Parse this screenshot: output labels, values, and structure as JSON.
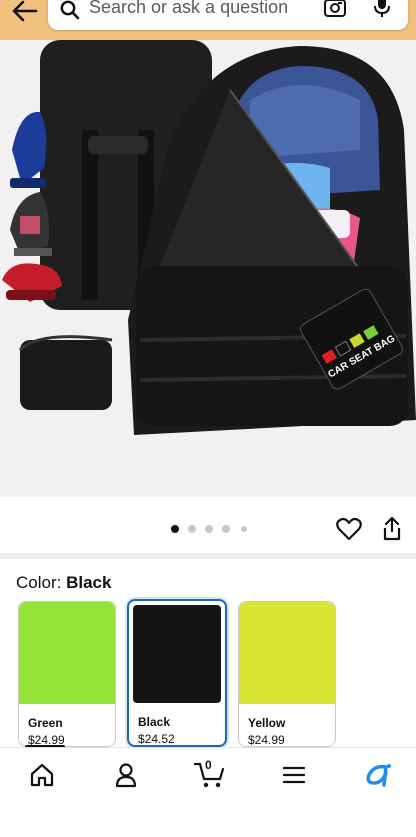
{
  "search": {
    "placeholder": "Search or ask a question"
  },
  "product": {
    "color_label": "Color: ",
    "color_value": "Black",
    "image_badge_text": "CAR SEAT BAG",
    "carousel_dots": 5,
    "active_dot": 0
  },
  "swatches": [
    {
      "name": "Green",
      "price": "$24.99",
      "color": "#95e337"
    },
    {
      "name": "Black",
      "price": "$24.52",
      "color": "#141414"
    },
    {
      "name": "Yellow",
      "price": "$24.99",
      "color": "#d8e431"
    }
  ],
  "selected_swatch": "Black",
  "nav": {
    "cart_count": "0"
  },
  "colors": {
    "header": "#f1c07e",
    "accent": "#1b68b6",
    "brand_icon": "#1f8ef1"
  }
}
